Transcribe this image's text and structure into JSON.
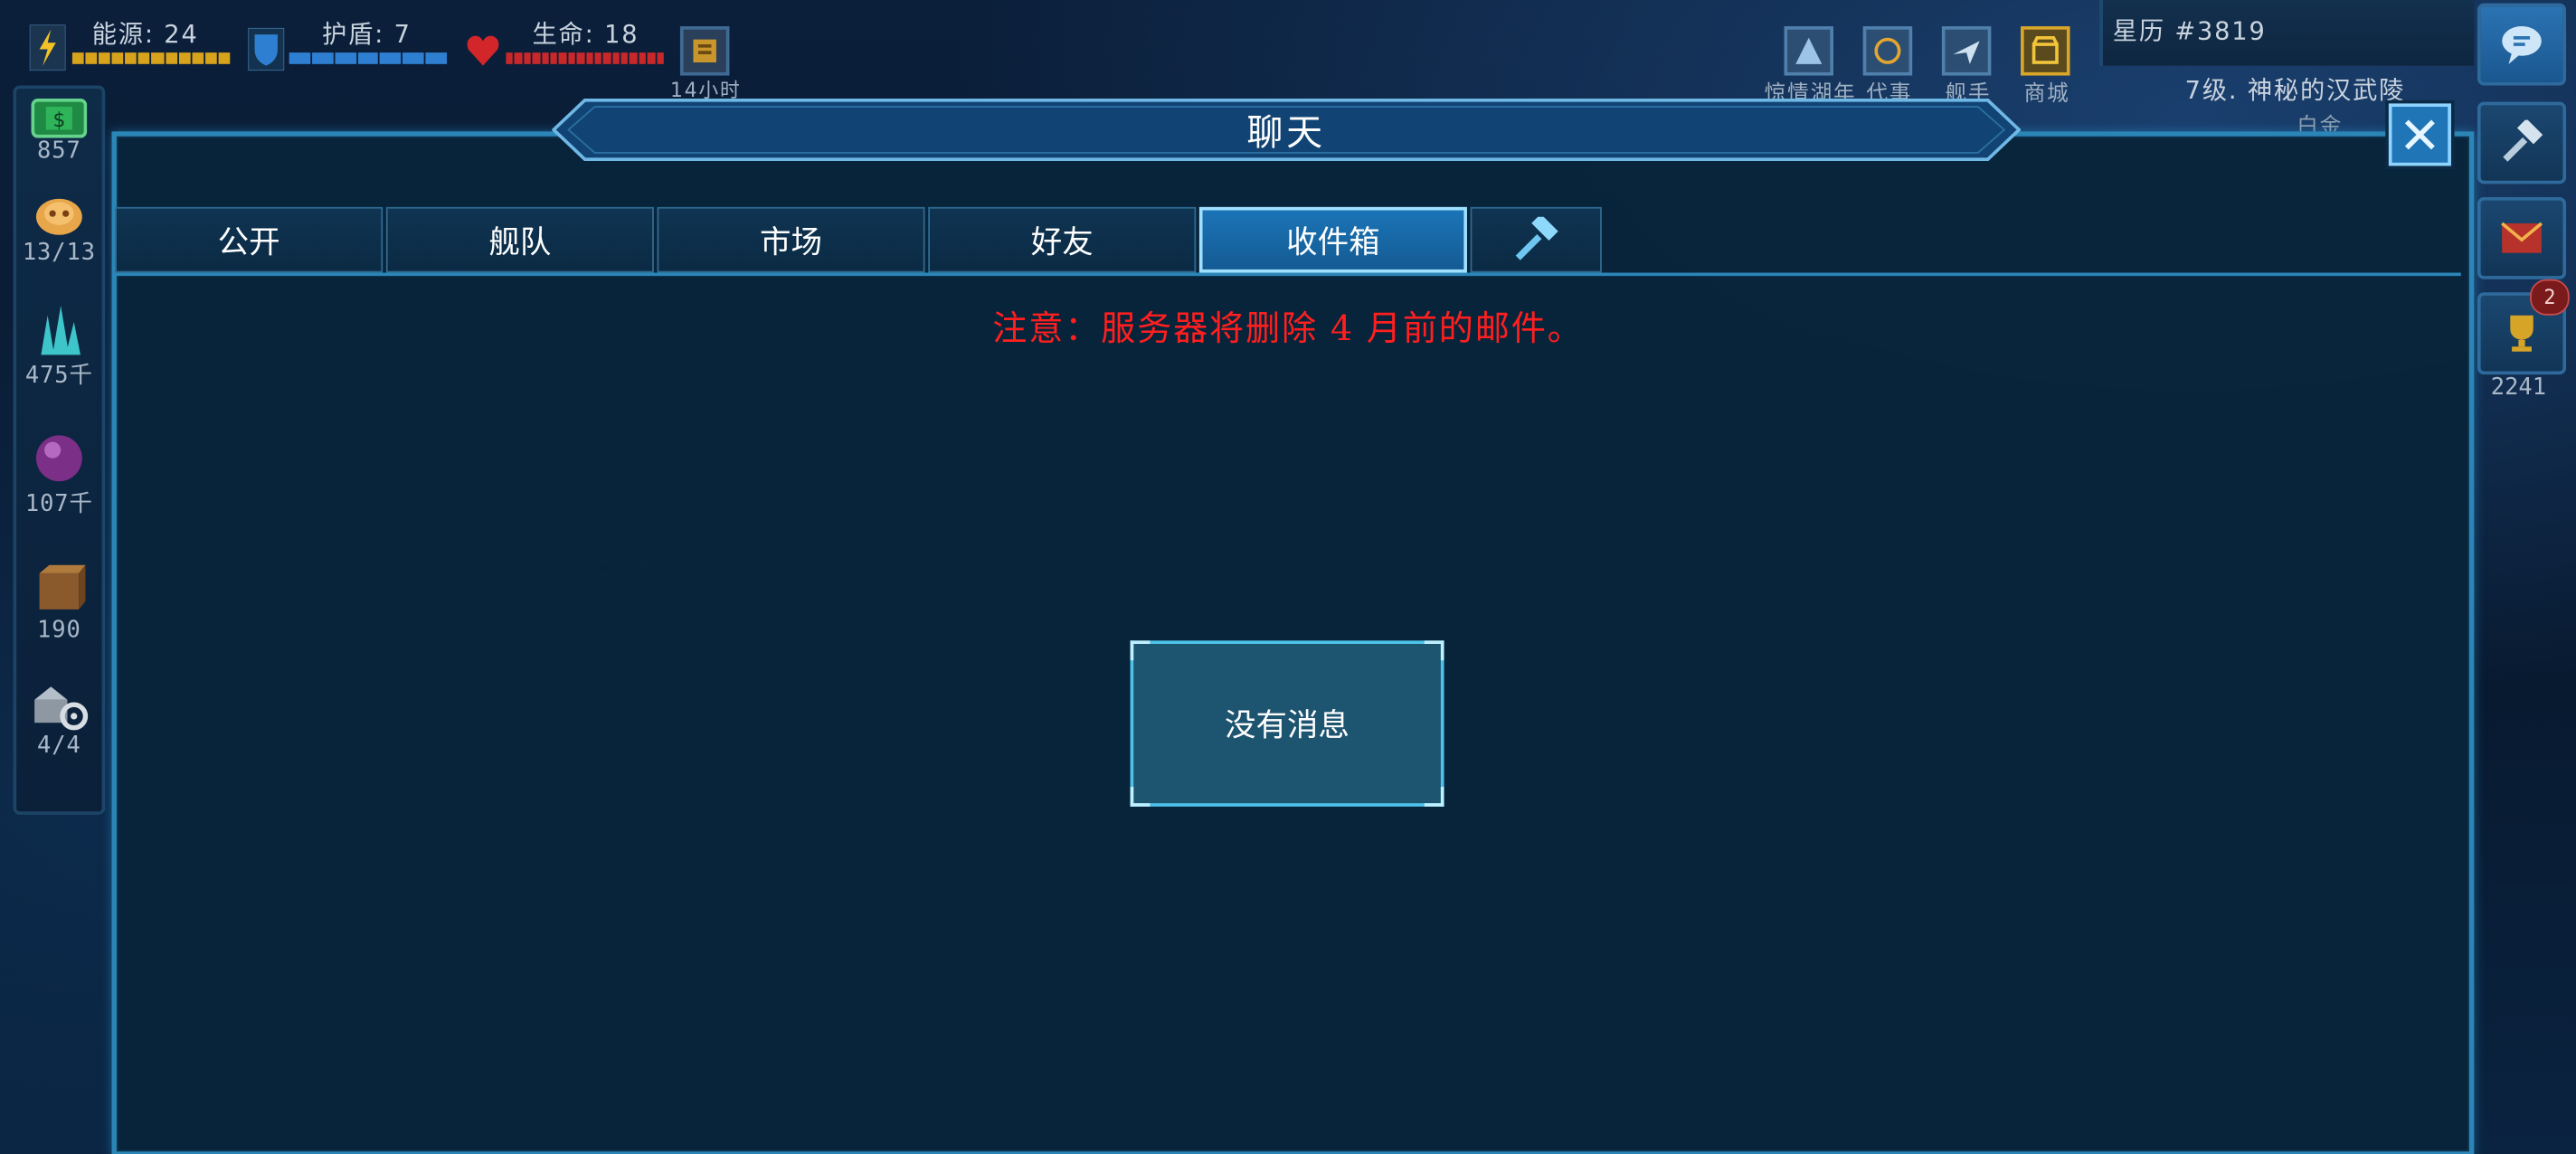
{
  "hud": {
    "energy": {
      "label": "能源: 24",
      "fill": 1.0,
      "color": "#d7a21c"
    },
    "shield": {
      "label": "护盾: 7",
      "fill": 1.0,
      "color": "#2e7fd1"
    },
    "life": {
      "label": "生命: 18",
      "fill": 1.0,
      "color": "#c8282a"
    },
    "timer_label": "14小时",
    "top_menu": [
      "惊情湖年",
      "代事",
      "舰手",
      "商城"
    ],
    "stardate": "星历 #3819",
    "rank_text": "7级. 神秘的汉武陵",
    "rank_sub": "白金"
  },
  "resources": [
    {
      "name": "credits",
      "value": "857"
    },
    {
      "name": "crew",
      "value": "13/13"
    },
    {
      "name": "crystal",
      "value": "475千"
    },
    {
      "name": "orb",
      "value": "107千"
    },
    {
      "name": "crate",
      "value": "190"
    },
    {
      "name": "drones",
      "value": "4/4"
    }
  ],
  "right": {
    "trophy_badge": "2",
    "trophy_value": "2241"
  },
  "panel": {
    "title": "聊天",
    "tabs": [
      "公开",
      "舰队",
      "市场",
      "好友",
      "收件箱"
    ],
    "active_tab": "收件箱",
    "notice": "注意：服务器将删除 4 月前的邮件。",
    "empty_message": "没有消息"
  },
  "colors": {
    "accent": "#2b86b7",
    "notice": "#ff1f1f",
    "active_tab": "#1b74b7"
  }
}
